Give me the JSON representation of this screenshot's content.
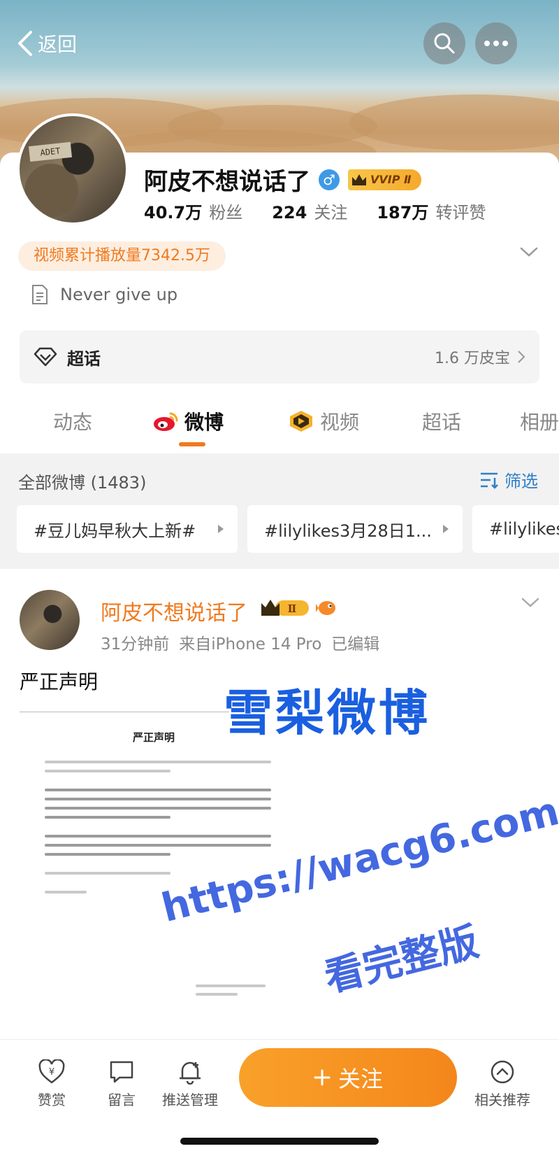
{
  "header": {
    "back_label": "返回",
    "search_icon": "search-icon",
    "more_icon": "more-icon"
  },
  "profile": {
    "name": "阿皮不想说话了",
    "gender_symbol": "♂",
    "vip_label": "VVIP Ⅱ",
    "stats": [
      {
        "num": "40.7万",
        "label": "粉丝"
      },
      {
        "num": "224",
        "label": "关注"
      },
      {
        "num": "187万",
        "label": "转评赞"
      }
    ],
    "play_badge": "视频累计播放量7342.5万",
    "bio": "Never give up",
    "supertopic": {
      "label": "超话",
      "count": "1.6 万皮宝"
    }
  },
  "tabs": [
    {
      "label": "动态"
    },
    {
      "label": "微博"
    },
    {
      "label": "视频"
    },
    {
      "label": "超话"
    },
    {
      "label": "相册"
    }
  ],
  "feed": {
    "all_count": "全部微博 (1483)",
    "filter_label": "筛选",
    "chips": [
      "#豆儿妈早秋大上新#",
      "#lilylikes3月28日1...",
      "#lilylikes"
    ]
  },
  "post": {
    "author": "阿皮不想说话了",
    "badge_label": "Ⅱ",
    "time": "31分钟前",
    "source": "来自iPhone 14 Pro",
    "edited": "已编辑",
    "text": "严正声明",
    "doc_title": "严正声明",
    "watermark": "雪梨微博",
    "url_mark": "https://wacg6.com",
    "url_sub": "看完整版"
  },
  "bottom_bar": {
    "items": [
      {
        "label": "赞赏",
        "icon": "heart-yen-icon"
      },
      {
        "label": "留言",
        "icon": "comment-icon"
      },
      {
        "label": "推送管理",
        "icon": "bell-plus-icon"
      },
      {
        "label": "相关推荐",
        "icon": "chevron-up-circle-icon"
      }
    ],
    "follow_label": "关注"
  },
  "colors": {
    "accent": "#f07a1f",
    "link_blue": "#2f7fc8",
    "watermark_blue": "#1a5fe0"
  }
}
